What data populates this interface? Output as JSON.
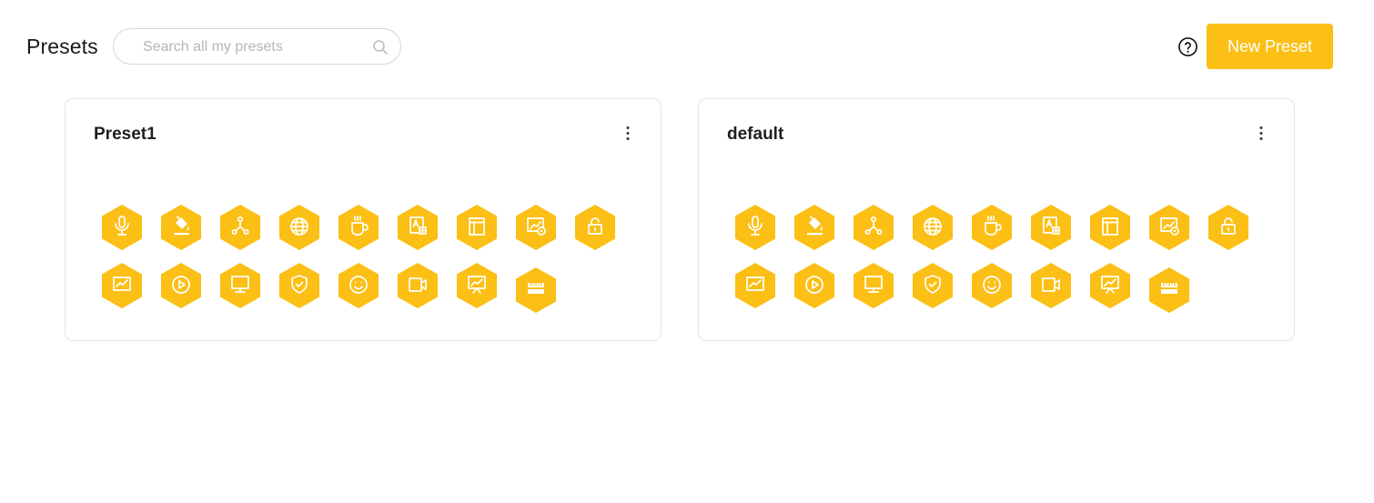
{
  "header": {
    "title": "Presets",
    "search_placeholder": "Search all my presets",
    "new_button_label": "New Preset",
    "help_icon": "question-circle-icon"
  },
  "colors": {
    "accent": "#fbbf15",
    "border": "#e6e6e6",
    "text": "#1f1f1f",
    "placeholder": "#b5b5b5"
  },
  "presets": [
    {
      "name": "Preset1",
      "menu_icon": "more-vertical-icon",
      "icons": [
        [
          "microphone",
          "paint-bucket",
          "network-nodes",
          "globe",
          "coffee-cup",
          "translate",
          "layout-panel",
          "image-monitor-eye",
          "unlock"
        ],
        [
          "line-chart",
          "play-circle",
          "desktop-monitor",
          "shield-check",
          "smiley",
          "video-camera",
          "presentation-chart",
          "ruler"
        ]
      ]
    },
    {
      "name": "default",
      "menu_icon": "more-vertical-icon",
      "icons": [
        [
          "microphone",
          "paint-bucket",
          "network-nodes",
          "globe",
          "coffee-cup",
          "translate",
          "layout-panel",
          "image-monitor-eye",
          "unlock"
        ],
        [
          "line-chart",
          "play-circle",
          "desktop-monitor",
          "shield-check",
          "smiley",
          "video-camera",
          "presentation-chart",
          "ruler"
        ]
      ]
    }
  ]
}
